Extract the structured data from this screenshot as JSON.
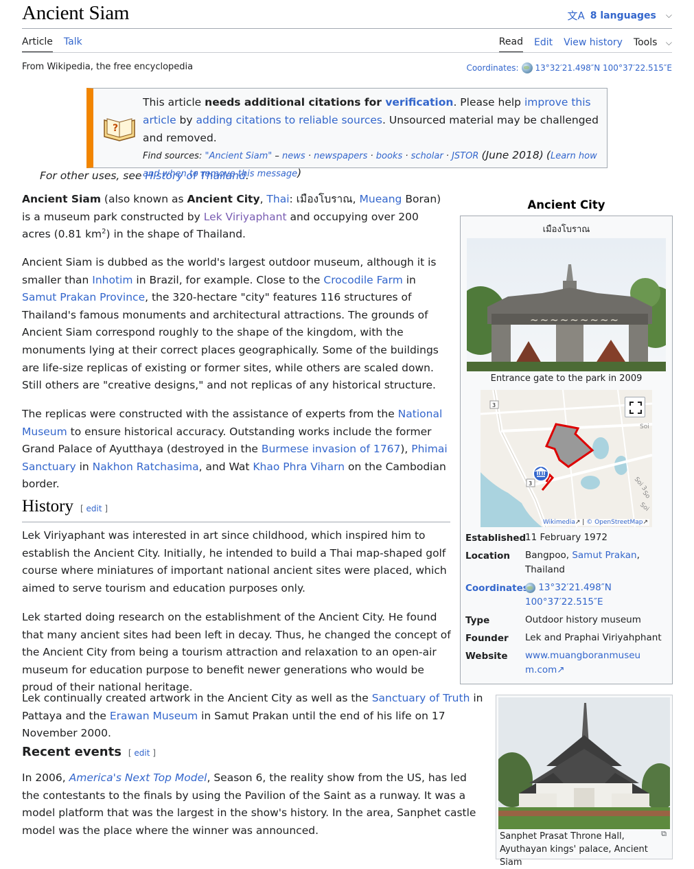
{
  "header": {
    "title": "Ancient Siam",
    "languages": "8 languages"
  },
  "tabs_left": [
    "Article",
    "Talk"
  ],
  "tabs_right": [
    "Read",
    "Edit",
    "View history",
    "Tools"
  ],
  "tagline": "From Wikipedia, the free encyclopedia",
  "coords_top_label": "Coordinates:",
  "coords_top_value": "13°32′21.498″N 100°37′22.515″E",
  "ambox": {
    "s1": "This article ",
    "s2": "needs additional citations for ",
    "s3": "verification",
    "s4": ". Please help ",
    "s5": "improve this article",
    "s6": " by ",
    "s7": "adding citations to reliable sources",
    "s8": ". Unsourced material may be challenged and removed.",
    "find": "Find sources:",
    "q": "\"Ancient Siam\"",
    "dash": " – ",
    "news": "news",
    "newspapers": "newspapers",
    "books": "books",
    "scholar": "scholar",
    "jstor": "JSTOR",
    "date": "(June 2018)",
    "learn": "Learn how and when to remove this message"
  },
  "hatnote": {
    "pre": "For other uses, see ",
    "link": "History of Thailand",
    "post": "."
  },
  "p1": {
    "b1": "Ancient Siam",
    "t1": " (also known as ",
    "b2": "Ancient City",
    "t2": ", ",
    "l1": "Thai",
    "t3": ": เมืองโบราณ, ",
    "l2": "Mueang",
    "t4": " Boran) is a museum park constructed by ",
    "l3": "Lek Viriyaphant",
    "t5": " and occupying over 200 acres (0.81 km",
    "sup": "2",
    "t6": ") in the shape of Thailand."
  },
  "p2": {
    "t1": "Ancient Siam is dubbed as the world's largest outdoor museum, although it is smaller than ",
    "l1": "Inhotim",
    "t2": " in Brazil, for example. Close to the ",
    "l2": "Crocodile Farm",
    "t3": " in ",
    "l3": "Samut Prakan Province",
    "t4": ", the 320-hectare \"city\" features 116 structures of Thailand's famous monuments and architectural attractions. The grounds of Ancient Siam correspond roughly to the shape of the kingdom, with the monuments lying at their correct places geographically. Some of the buildings are life-size replicas of existing or former sites, while others are scaled down. Still others are \"creative designs,\" and not replicas of any historical structure."
  },
  "p3": {
    "t1": "The replicas were constructed with the assistance of experts from the ",
    "l1": "National Museum",
    "t2": " to ensure historical accuracy. Outstanding works include the former Grand Palace of Ayutthaya (destroyed in the ",
    "l2": "Burmese invasion of 1767",
    "t3": "), ",
    "l3": "Phimai Sanctuary",
    "t4": " in ",
    "l4": "Nakhon Ratchasima",
    "t5": ", and Wat ",
    "l5": "Khao Phra Viharn",
    "t6": " on the Cambodian border."
  },
  "history": {
    "heading": "History",
    "edit": "edit",
    "p1": "Lek Viriyaphant was interested in art since childhood, which inspired him to establish the Ancient City. Initially, he intended to build a Thai map-shaped golf course where miniatures of important national ancient sites were placed, which aimed to serve tourism and education purposes only.",
    "p2": "Lek started doing research on the establishment of the Ancient City. He found that many ancient sites had been left in decay. Thus, he changed the concept of the Ancient City from being a tourism attraction and relaxation to an open-air museum for education purpose to benefit newer generations who would be proud of their national heritage.",
    "p3_t1": "Lek continually created artwork in the Ancient City as well as the ",
    "p3_l1": "Sanctuary of Truth",
    "p3_t2": " in Pattaya and the ",
    "p3_l2": "Erawan Museum",
    "p3_t3": " in Samut Prakan until the end of his life on 17 November 2000."
  },
  "recent": {
    "heading": "Recent events",
    "edit": "edit",
    "t1": "In 2006, ",
    "l1": "America's Next Top Model",
    "t2": ", Season 6, the reality show from the US, has led the contestants to the finals by using the Pavilion of the Saint as a runway. It was a model platform that was the largest in the show's history. In the area, Sanphet castle model was the place where the winner was announced."
  },
  "infobox": {
    "title": "Ancient City",
    "subtitle": "เมืองโบราณ",
    "photo_caption": "Entrance gate to the park in 2009",
    "map": {
      "road_label_1": "3",
      "road_label_2": "3",
      "place_labels": [
        "Soi",
        "Soi 3",
        "So",
        "Soi"
      ],
      "credit_1": "Wikimedia",
      "credit_2": "© OpenStreetMap"
    },
    "rows": [
      {
        "label": "Established",
        "value": "11 February 1972"
      },
      {
        "label": "Location",
        "value_pre": "Bangpoo, ",
        "value_link": "Samut Prakan",
        "value_post": ", Thailand"
      },
      {
        "label": "Coordinates",
        "value": "13°32′21.498″N 100°37′22.515″E"
      },
      {
        "label": "Type",
        "value": "Outdoor history museum"
      },
      {
        "label": "Founder",
        "value": "Lek and Praphai Viriyahphant"
      },
      {
        "label": "Website",
        "value": "www.muangboranmuseum.com"
      }
    ]
  },
  "thumb": {
    "caption": "Sanphet Prasat Throne Hall, Ayuthayan kings' palace, Ancient Siam"
  },
  "icons": {
    "language": "文A",
    "chevron": "⌵",
    "external": "↗",
    "magnify": "⧉"
  },
  "colors": {
    "link": "#3366cc",
    "visited": "#795cb2",
    "ambox_stripe": "#f28500",
    "park_fill": "#999999",
    "park_border": "#dd0000"
  }
}
